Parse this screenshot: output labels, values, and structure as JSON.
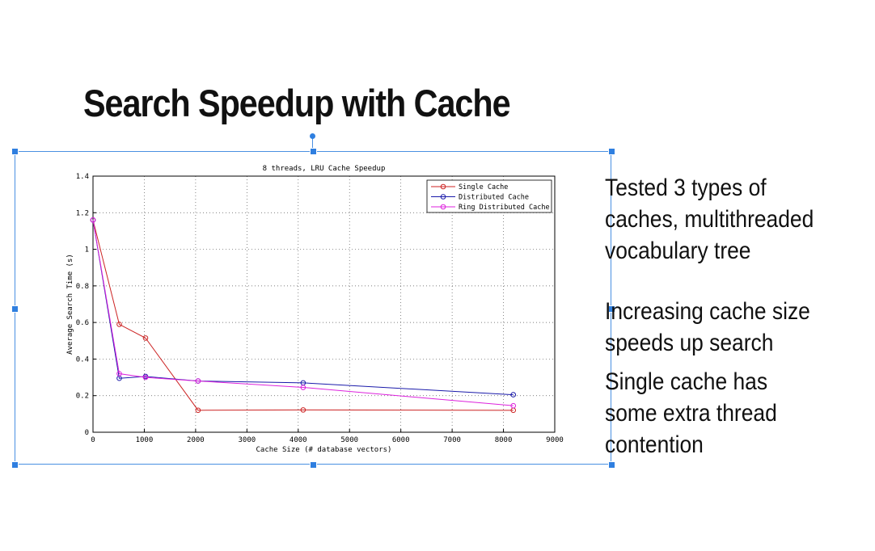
{
  "slide": {
    "title": "Search Speedup with Cache",
    "bullets": [
      "Tested 3 types of\ncaches, multithreaded\nvocabulary tree",
      "Increasing cache size\nspeeds up search",
      "Single cache has\nsome extra thread\ncontention"
    ]
  },
  "colors": {
    "selection": "#4a90e2",
    "single": "#cc2222",
    "distributed": "#1a1aaa",
    "ring": "#dd22dd"
  },
  "chart_data": {
    "type": "line",
    "title": "8 threads, LRU Cache Speedup",
    "xlabel": "Cache Size (# database vectors)",
    "ylabel": "Average Search Time (s)",
    "xlim": [
      0,
      9000
    ],
    "ylim": [
      0,
      1.4
    ],
    "xticks": [
      0,
      1000,
      2000,
      3000,
      4000,
      5000,
      6000,
      7000,
      8000,
      9000
    ],
    "yticks": [
      0,
      0.2,
      0.4,
      0.6,
      0.8,
      1,
      1.2,
      1.4
    ],
    "grid": true,
    "legend_position": "top-right",
    "series": [
      {
        "name": "Single Cache",
        "color": "#cc2222",
        "x": [
          0,
          512,
          1024,
          2048,
          4096,
          8192
        ],
        "y": [
          1.16,
          0.59,
          0.515,
          0.12,
          0.122,
          0.12
        ]
      },
      {
        "name": "Distributed Cache",
        "color": "#1a1aaa",
        "x": [
          0,
          512,
          1024,
          2048,
          4096,
          8192
        ],
        "y": [
          1.16,
          0.295,
          0.305,
          0.28,
          0.27,
          0.205
        ]
      },
      {
        "name": "Ring Distributed Cache",
        "color": "#dd22dd",
        "x": [
          0,
          512,
          1024,
          2048,
          4096,
          8192
        ],
        "y": [
          1.16,
          0.32,
          0.3,
          0.28,
          0.245,
          0.145
        ]
      }
    ]
  }
}
